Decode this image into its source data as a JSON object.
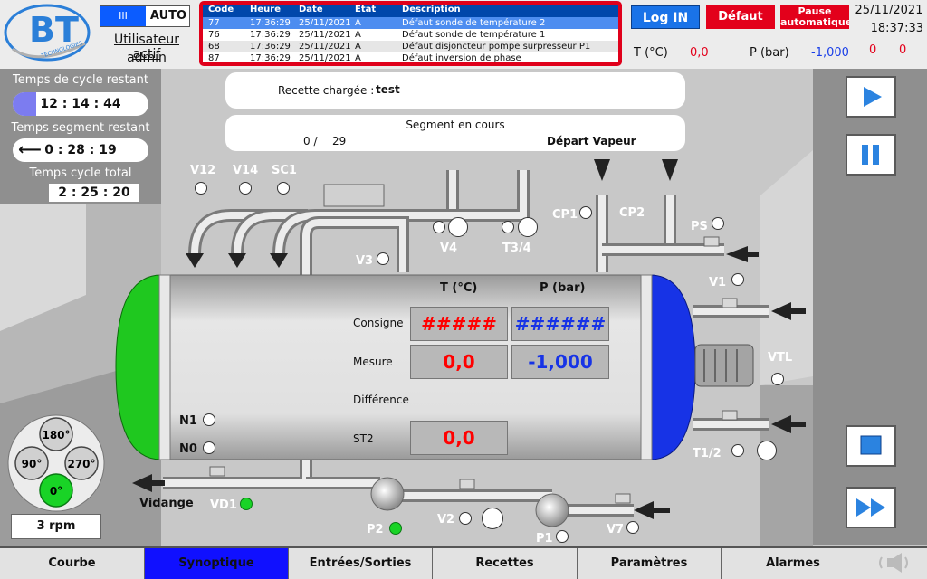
{
  "header": {
    "logo_text": "BT",
    "logo_subtext": "TECHNOLOGIES",
    "mode_toggle_glyph": "III",
    "mode_label": "AUTO",
    "user_label": "Utilisateur actif",
    "user_name": "admin",
    "login_label": "Log IN",
    "fault_label": "Défaut",
    "pause_label": "Pause automatique",
    "date": "25/11/2021",
    "time": "18:37:33",
    "temp_label": "T (°C)",
    "temp_value": "0,0",
    "pressure_label": "P (bar)",
    "pressure_value": "-1,000",
    "counter_1": "0",
    "counter_2": "0"
  },
  "alarms": {
    "columns": [
      "Code",
      "Heure",
      "Date",
      "Etat",
      "Description"
    ],
    "rows": [
      {
        "code": "77",
        "time": "17:36:29",
        "date": "25/11/2021",
        "state": "A",
        "desc": "Défaut sonde de température 2"
      },
      {
        "code": "76",
        "time": "17:36:29",
        "date": "25/11/2021",
        "state": "A",
        "desc": "Défaut sonde de température 1"
      },
      {
        "code": "68",
        "time": "17:36:29",
        "date": "25/11/2021",
        "state": "A",
        "desc": "Défaut disjoncteur pompe surpresseur P1"
      },
      {
        "code": "87",
        "time": "17:36:29",
        "date": "25/11/2021",
        "state": "A",
        "desc": "Défaut inversion de phase"
      }
    ]
  },
  "timers": {
    "cycle_remaining_label": "Temps de cycle restant",
    "cycle_remaining_value": "12 :  14 : 44",
    "segment_remaining_label": "Temps segment restant",
    "segment_remaining_value": "0 :  28 : 19",
    "cycle_total_label": "Temps cycle total",
    "cycle_total_value": "2 :  25 : 20"
  },
  "recipe": {
    "loaded_label": "Recette chargée :",
    "loaded_value": "test",
    "segment_label": "Segment en cours",
    "segment_current": "0 /",
    "segment_total": "29",
    "segment_name": "Départ Vapeur"
  },
  "process": {
    "col_temp": "T (°C)",
    "col_pressure": "P (bar)",
    "row_setpoint": "Consigne",
    "row_measure": "Mesure",
    "row_difference": "Différence",
    "row_st2": "ST2",
    "setpoint_temp": "#####",
    "setpoint_pressure": "######",
    "measure_temp": "0,0",
    "measure_pressure": "-1,000",
    "st2_value": "0,0"
  },
  "labels": {
    "v12": "V12",
    "v14": "V14",
    "sc1": "SC1",
    "cp1": "CP1",
    "cp2": "CP2",
    "ps": "PS",
    "v4": "V4",
    "t34": "T3/4",
    "v3": "V3",
    "v1": "V1",
    "vtl": "VTL",
    "t12": "T1/2",
    "n1": "N1",
    "n0": "N0",
    "vidange": "Vidange",
    "vd1": "VD1",
    "p2": "P2",
    "v2": "V2",
    "p1": "P1",
    "v7": "V7"
  },
  "rotation": {
    "angles": [
      "180°",
      "90°",
      "270°",
      "0°"
    ],
    "active_angle": "0°",
    "speed": "3 rpm"
  },
  "nav": {
    "tabs": [
      "Courbe",
      "Synoptique",
      "Entrées/Sorties",
      "Recettes",
      "Paramètres",
      "Alarmes"
    ],
    "active": "Synoptique"
  },
  "colors": {
    "accent_blue": "#1010ff",
    "alarm_red": "#e3001b",
    "tank_left": "#1fc81f",
    "tank_right": "#1733e6"
  },
  "icons": {
    "play": "play-icon",
    "pause": "pause-icon",
    "stop": "stop-icon",
    "fast_forward": "fast-forward-icon",
    "sound": "sound-icon"
  }
}
